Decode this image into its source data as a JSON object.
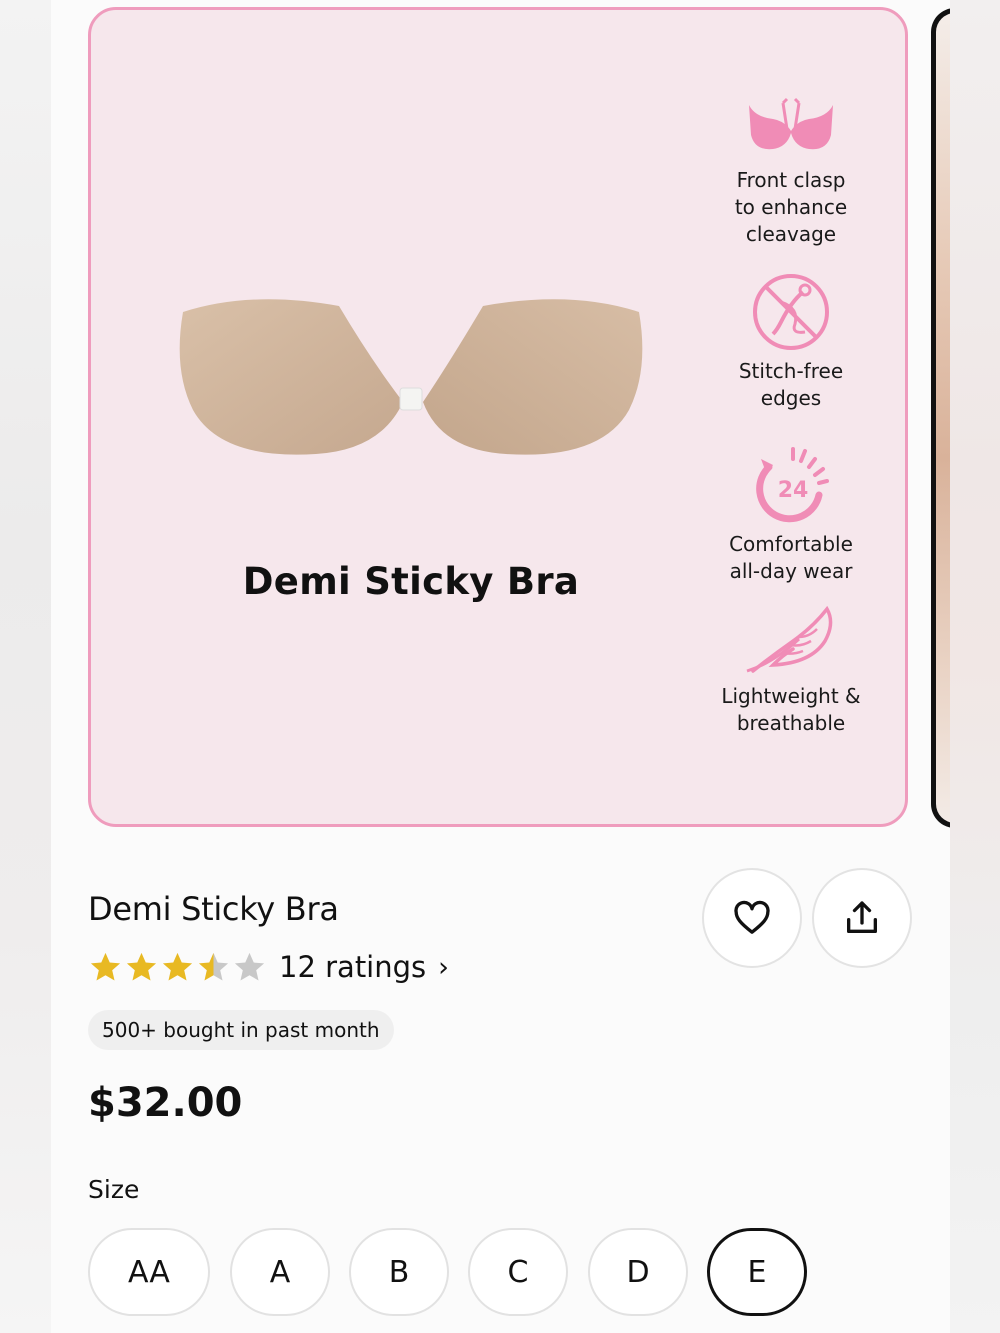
{
  "hero": {
    "title": "Demi Sticky Bra",
    "features": [
      {
        "icon": "front-clasp-bra-icon",
        "text": "Front clasp\nto enhance\ncleavage"
      },
      {
        "icon": "no-stitch-icon",
        "text": "Stitch-free\nedges"
      },
      {
        "icon": "24-hour-icon",
        "text": "Comfortable\nall-day wear",
        "icon_text": "24"
      },
      {
        "icon": "feather-icon",
        "text": "Lightweight &\nbreathable"
      }
    ]
  },
  "product": {
    "title": "Demi Sticky Bra",
    "rating": 3.5,
    "rating_text": "12 ratings",
    "bought_badge": "500+ bought in past month",
    "price": "$32.00"
  },
  "size": {
    "label": "Size",
    "options": [
      "AA",
      "A",
      "B",
      "C",
      "D",
      "E"
    ],
    "selected": "E"
  },
  "colors": {
    "accent_pink": "#f08cb6",
    "card_bg": "#f6e7ec",
    "card_border": "#ef9cbd",
    "star_gold": "#e8b923",
    "star_gray": "#c8c8c8"
  }
}
